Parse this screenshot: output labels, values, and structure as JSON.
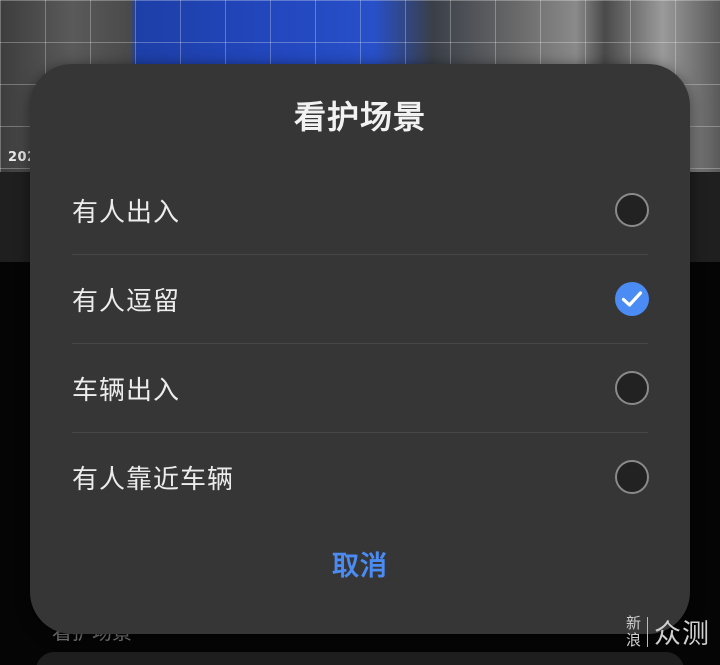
{
  "background": {
    "camera_timestamp_fragment": "202",
    "peek_label": "看护场景",
    "accent_color": "#4b8bf4"
  },
  "dialog": {
    "title": "看护场景",
    "options": [
      {
        "label": "有人出入",
        "selected": false
      },
      {
        "label": "有人逗留",
        "selected": true
      },
      {
        "label": "车辆出入",
        "selected": false
      },
      {
        "label": "有人靠近车辆",
        "selected": false
      }
    ],
    "cancel_label": "取消",
    "selected_icon": "check-icon",
    "unselected_icon": "radio-empty-icon"
  },
  "watermark": {
    "line1": "新",
    "line2": "浪",
    "brand": "众测"
  }
}
